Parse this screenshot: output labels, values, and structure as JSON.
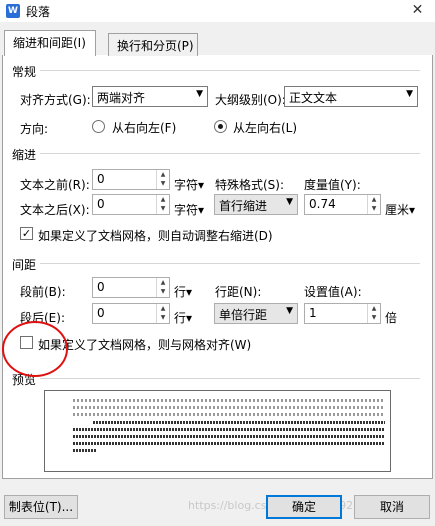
{
  "window": {
    "title": "段落",
    "app_icon": "W",
    "close": "✕"
  },
  "tabs": [
    {
      "label": "缩进和间距(I)"
    },
    {
      "label": "换行和分页(P)"
    }
  ],
  "general": {
    "section": "常规",
    "align_label": "对齐方式(G):",
    "align_value": "两端对齐",
    "outline_label": "大纲级别(O):",
    "outline_value": "正文文本",
    "direction_label": "方向:",
    "rtl_label": "从右向左(F)",
    "ltr_label": "从左向右(L)",
    "direction_selected": "ltr"
  },
  "indent": {
    "section": "缩进",
    "before_label": "文本之前(R):",
    "before_value": "0",
    "before_unit": "字符▾",
    "after_label": "文本之后(X):",
    "after_value": "0",
    "after_unit": "字符▾",
    "special_label": "特殊格式(S):",
    "special_value": "首行缩进",
    "measure_label": "度量值(Y):",
    "measure_value": "0.74",
    "measure_unit": "厘米▾",
    "grid_check_label": "如果定义了文档网格，则自动调整右缩进(D)",
    "grid_check_checked": true
  },
  "spacing": {
    "section": "间距",
    "before_label": "段前(B):",
    "before_value": "0",
    "before_unit": "行▾",
    "after_label": "段后(E):",
    "after_value": "0",
    "after_unit": "行▾",
    "line_label": "行距(N):",
    "line_value": "单倍行距",
    "set_label": "设置值(A):",
    "set_value": "1",
    "set_unit": "倍",
    "snap_check_label": "如果定义了文档网格，则与网格对齐(W)",
    "snap_check_checked": false
  },
  "preview": {
    "section": "预览"
  },
  "buttons": {
    "tabs_label": "制表位(T)...",
    "ok_label": "确定",
    "cancel_label": "取消"
  },
  "watermark": "https://blog.csdn.net/qq_2992116",
  "colors": {
    "accent": "#0078d7",
    "annotation": "#e01010"
  }
}
